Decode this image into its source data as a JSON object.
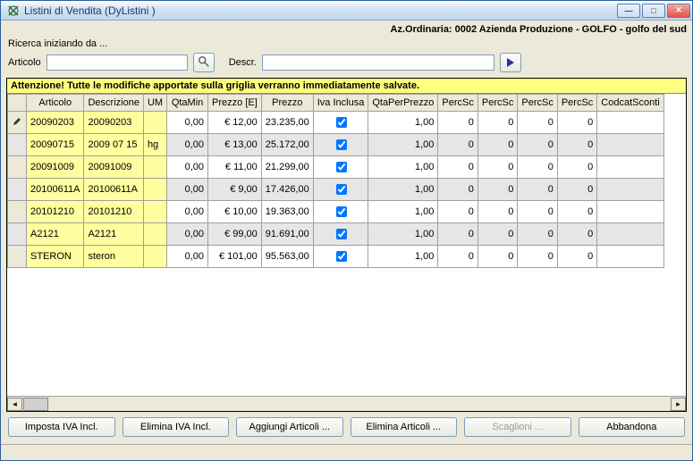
{
  "window": {
    "title": "Listini di Vendita   (DyListini )"
  },
  "header": "Az.Ordinaria: 0002 Azienda Produzione - GOLFO - golfo del sud",
  "search": {
    "begin_label": "Ricerca iniziando da ...",
    "articolo_label": "Articolo",
    "articolo_value": "",
    "descr_label": "Descr.",
    "descr_value": ""
  },
  "warning": "Attenzione! Tutte le modifiche apportate sulla griglia verranno immediatamente salvate.",
  "columns": [
    "Articolo",
    "Descrizione",
    "UM",
    "QtaMin",
    "Prezzo [E]",
    "Prezzo",
    "Iva Inclusa",
    "QtaPerPrezzo",
    "PercSc",
    "PercSc",
    "PercSc",
    "PercSc",
    "CodcatSconti"
  ],
  "rows": [
    {
      "editing": true,
      "articolo": "20090203",
      "descr": "20090203",
      "um": "",
      "qtamin": "0,00",
      "prezzoe": "€ 12,00",
      "prezzo": "23.235,00",
      "iva": true,
      "qpp": "1,00",
      "p1": "0",
      "p2": "0",
      "p3": "0",
      "p4": "0",
      "cod": ""
    },
    {
      "editing": false,
      "articolo": "20090715",
      "descr": "2009 07 15",
      "um": "hg",
      "qtamin": "0,00",
      "prezzoe": "€ 13,00",
      "prezzo": "25.172,00",
      "iva": true,
      "qpp": "1,00",
      "p1": "0",
      "p2": "0",
      "p3": "0",
      "p4": "0",
      "cod": ""
    },
    {
      "editing": false,
      "articolo": "20091009",
      "descr": "20091009",
      "um": "",
      "qtamin": "0,00",
      "prezzoe": "€ 11,00",
      "prezzo": "21.299,00",
      "iva": true,
      "qpp": "1,00",
      "p1": "0",
      "p2": "0",
      "p3": "0",
      "p4": "0",
      "cod": ""
    },
    {
      "editing": false,
      "articolo": "20100611A",
      "descr": "20100611A",
      "um": "",
      "qtamin": "0,00",
      "prezzoe": "€ 9,00",
      "prezzo": "17.426,00",
      "iva": true,
      "qpp": "1,00",
      "p1": "0",
      "p2": "0",
      "p3": "0",
      "p4": "0",
      "cod": ""
    },
    {
      "editing": false,
      "articolo": "20101210",
      "descr": "20101210",
      "um": "",
      "qtamin": "0,00",
      "prezzoe": "€ 10,00",
      "prezzo": "19.363,00",
      "iva": true,
      "qpp": "1,00",
      "p1": "0",
      "p2": "0",
      "p3": "0",
      "p4": "0",
      "cod": ""
    },
    {
      "editing": false,
      "articolo": "A2121",
      "descr": "A2121",
      "um": "",
      "qtamin": "0,00",
      "prezzoe": "€ 99,00",
      "prezzo": "91.691,00",
      "iva": true,
      "qpp": "1,00",
      "p1": "0",
      "p2": "0",
      "p3": "0",
      "p4": "0",
      "cod": ""
    },
    {
      "editing": false,
      "articolo": "STERON",
      "descr": "steron",
      "um": "",
      "qtamin": "0,00",
      "prezzoe": "€ 101,00",
      "prezzo": "95.563,00",
      "iva": true,
      "qpp": "1,00",
      "p1": "0",
      "p2": "0",
      "p3": "0",
      "p4": "0",
      "cod": ""
    }
  ],
  "buttons": {
    "imposta": "Imposta IVA Incl.",
    "elimina_iva": "Elimina IVA Incl.",
    "aggiungi": "Aggiungi Articoli ...",
    "elimina_art": "Elimina Articoli ...",
    "scaglioni": "Scaglioni ...",
    "abbandona": "Abbandona"
  }
}
